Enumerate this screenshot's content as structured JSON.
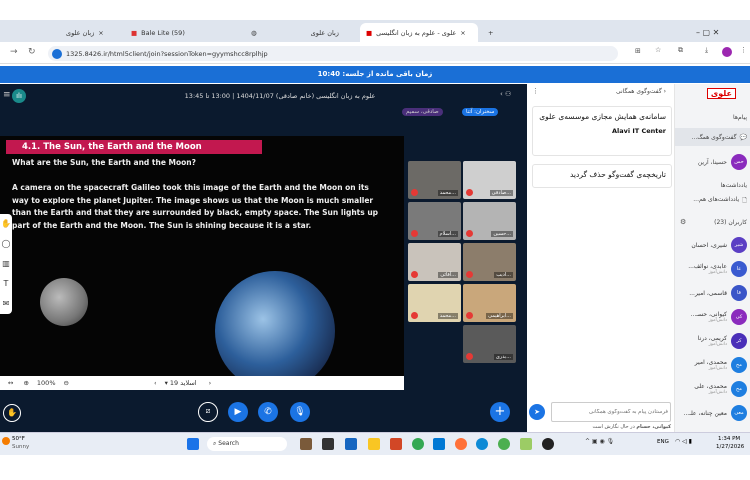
{
  "browser": {
    "tabs": [
      {
        "label": "زبان علوی"
      },
      {
        "label": "Bale Lite (59)"
      },
      {
        "label": "زبان علوی"
      },
      {
        "label": "علوی - علوم به زبان انگلیسی"
      }
    ],
    "url": "1325.8426.ir/html5client/join?sessionToken=gyymshcc8rplhjp"
  },
  "banner": {
    "text": "زمان باقی مانده از جلسه: 10:40"
  },
  "meeting": {
    "title": "علوم به زبان انگلیسی (خانم صادقی) 1404/11/07 | 13:00 تا 13:45",
    "badge_live": "سخنران: آتنا",
    "badge_presenter": "صادقی، سمیم"
  },
  "slide": {
    "title": "4.1. The Sun, the Earth and the Moon",
    "question": "What are the Sun, the Earth and the Moon?",
    "paragraph": "A camera on the spacecraft Galileo took this image of the Earth and the Moon on its way to explore the planet Jupiter. The image shows us that the Moon is much smaller than the Earth and that they are surrounded by black, empty space. The Sun lights up part of the Earth and the Moon. The Sun is shining because it is a star.",
    "zoom": "100%",
    "page_label": "اسلاید 19"
  },
  "videos": [
    "صادقی...",
    "محمد...",
    "حسین...",
    "اسلام...",
    "ادیب...",
    "آقائی...",
    "ابراهیمی...",
    "محمد...",
    "بدری..."
  ],
  "chat": {
    "header": "گفت‌وگوی همگانی",
    "welcome": "سامانه‌ی همایش مجازی موسسه‌ی علوی",
    "brand": "Alavi IT Center",
    "cleared": "تاریخچه‌ی گفت‌وگو حذف گردید",
    "input_placeholder": "فرستادن پیام به گفت‌وگوی همگانی",
    "typing_name": "کیوانی، حسام",
    "typing_text": "در حال نگارش است"
  },
  "sidebar": {
    "logo": "علوی",
    "messages_heading": "پیام‌ها",
    "public_chat": "گفت‌وگوی همگ...",
    "private_chat": "حسینا، آرین",
    "notes_heading": "یادداشت‌ها",
    "shared_notes": "یادداشت‌های هم...",
    "users_heading": "کاربران (23)",
    "users": [
      {
        "name": "شیری، احسان",
        "initials": "شیر",
        "sub": "",
        "color": "#5b3fc4"
      },
      {
        "name": "عابدی، نوائف...",
        "initials": "عا",
        "sub": "دانش‌آموز",
        "color": "#3a5bd0"
      },
      {
        "name": "قاسمی، امیر...",
        "initials": "قا",
        "sub": "",
        "color": "#3a55c8"
      },
      {
        "name": "کیوانی، حسـ...",
        "initials": "کی",
        "sub": "دانش‌آموز",
        "color": "#8a2bbd"
      },
      {
        "name": "کریمی، درنا",
        "initials": "کر",
        "sub": "دانش‌آموز",
        "color": "#4a2fb8"
      },
      {
        "name": "محمدی، امیر",
        "initials": "مح",
        "sub": "دانش‌آموز",
        "color": "#1e7ee0"
      },
      {
        "name": "محمدی، علی",
        "initials": "مح",
        "sub": "دانش‌آموز",
        "color": "#1e7ee0"
      },
      {
        "name": "معین چنانه، علـ...",
        "initials": "معی",
        "sub": "",
        "color": "#1e7ee0"
      }
    ]
  },
  "taskbar": {
    "weather_temp": "50°F",
    "weather_desc": "Sunny",
    "search": "Search",
    "lang": "ENG",
    "time": "1:34 PM",
    "date": "1/27/2026"
  }
}
